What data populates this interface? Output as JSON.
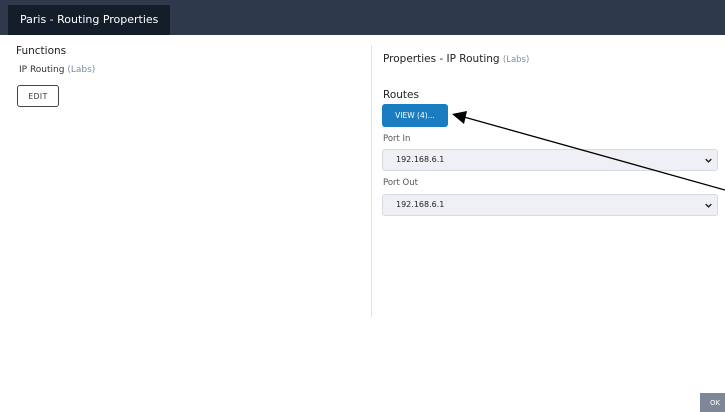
{
  "window": {
    "title": "Paris - Routing Properties"
  },
  "functions": {
    "heading": "Functions",
    "item_name": "IP Routing",
    "item_tag": "(Labs)",
    "edit_label": "EDIT"
  },
  "properties": {
    "heading": "Properties  - IP Routing",
    "heading_tag": "(Labs)",
    "routes_label": "Routes",
    "view_label": "VIEW (4)...",
    "port_in_label": "Port In",
    "port_in_value": "192.168.6.1",
    "port_out_label": "Port Out",
    "port_out_value": "192.168.6.1"
  },
  "footer": {
    "ok_label": "OK"
  },
  "colors": {
    "titlebar": "#2e3a4c",
    "title_tab": "#141e2b",
    "view_button": "#1a7cc1",
    "select_bg": "#eef0f6",
    "ok_button": "#7e8797"
  }
}
